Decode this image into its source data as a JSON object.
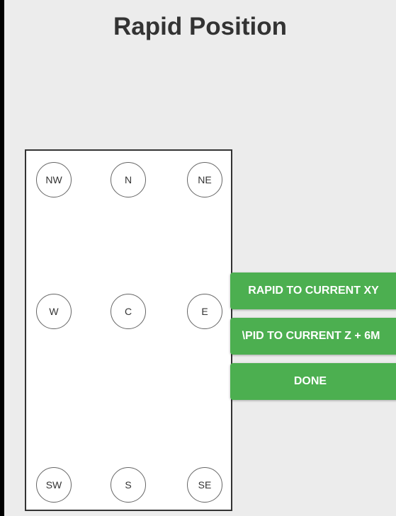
{
  "title": "Rapid Position",
  "positions": {
    "nw": "NW",
    "n": "N",
    "ne": "NE",
    "w": "W",
    "c": "C",
    "e": "E",
    "sw": "SW",
    "s": "S",
    "se": "SE"
  },
  "actions": {
    "rapid_xy": "RAPID TO CURRENT XY",
    "rapid_z": "\\PID TO CURRENT Z + 6M",
    "done": "DONE"
  },
  "colors": {
    "button_green": "#4caf50",
    "background": "#ececec"
  }
}
